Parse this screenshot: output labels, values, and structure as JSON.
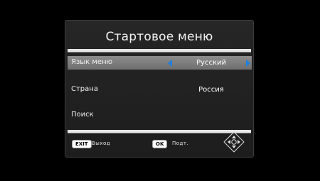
{
  "menu": {
    "title": "Стартовое меню",
    "rows": [
      {
        "label": "Язык меню",
        "value": "Русский"
      },
      {
        "label": "Страна",
        "value": "Россия"
      },
      {
        "label": "Поиск",
        "value": ""
      }
    ]
  },
  "footer": {
    "exit_key": "EXIT",
    "exit_label": "Выход",
    "ok_key": "OK",
    "ok_label": "Подт."
  },
  "colors": {
    "background": "#000000",
    "panel": "#222222",
    "highlight": "#7f7f7f",
    "arrow_accent": "#1e7fdc",
    "text": "#f0f0f0"
  },
  "icons": {
    "left_arrow": "triangle-left-icon",
    "right_arrow": "triangle-right-icon",
    "nav_pad": "dpad-icon"
  }
}
